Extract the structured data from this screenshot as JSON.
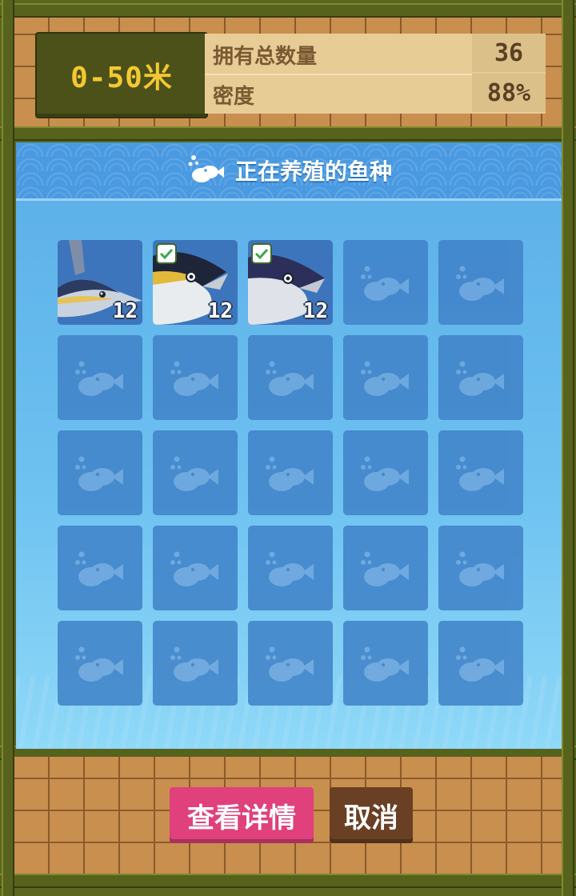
{
  "header": {
    "depth_range": "0-50米",
    "stats": [
      {
        "label": "拥有总数量",
        "value": "36"
      },
      {
        "label": "密度",
        "value": "88%"
      }
    ]
  },
  "panel": {
    "title": "正在养殖的鱼种",
    "title_icon": "fish-bubbles-icon"
  },
  "slots": [
    {
      "fish": "swordfish",
      "count": "12",
      "checked": false
    },
    {
      "fish": "yellowfin-tuna",
      "count": "12",
      "checked": true
    },
    {
      "fish": "bluefin-tuna",
      "count": "12",
      "checked": true
    }
  ],
  "empty_slot_icon": "fish-placeholder-icon",
  "buttons": {
    "details": "查看详情",
    "cancel": "取消"
  },
  "colors": {
    "details_button": "#e0407c",
    "cancel_button": "#6a4024",
    "depth_text": "#f4c832",
    "water": "#5aaee8"
  }
}
